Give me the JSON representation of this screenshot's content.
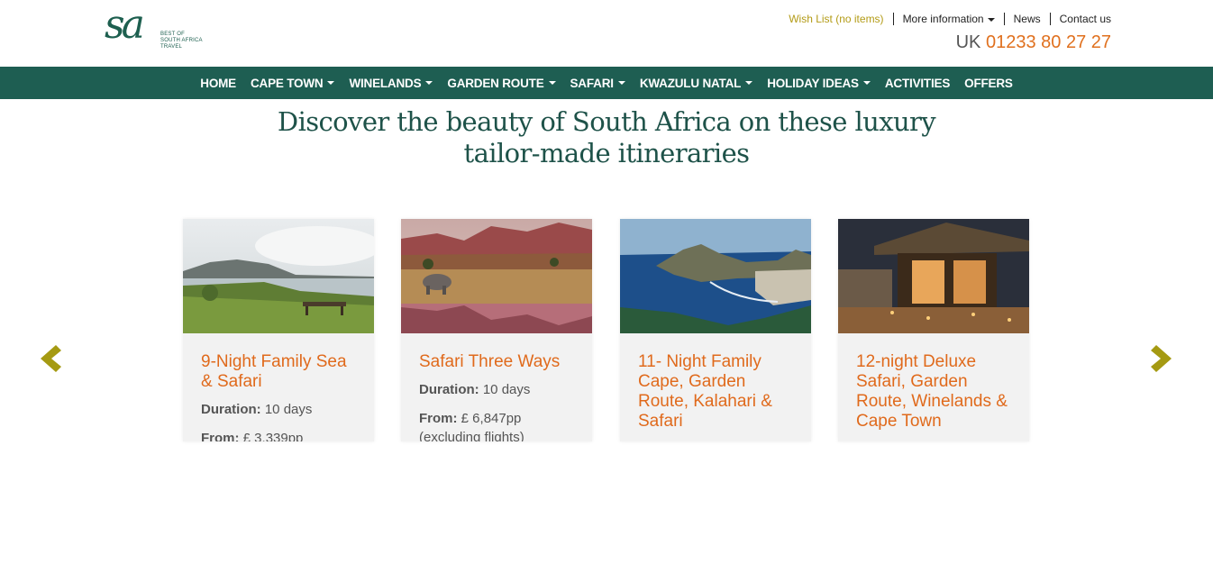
{
  "logo": {
    "mark": "sa",
    "lines": [
      "BEST OF",
      "SOUTH AFRICA",
      "TRAVEL"
    ]
  },
  "top_links": {
    "wish_list": "Wish List (no items)",
    "more_info": "More information",
    "news": "News",
    "contact": "Contact us"
  },
  "phone": {
    "prefix": "UK",
    "number": "01233 80 27 27"
  },
  "nav": {
    "items": [
      {
        "label": "HOME",
        "dropdown": false
      },
      {
        "label": "CAPE TOWN",
        "dropdown": true
      },
      {
        "label": "WINELANDS",
        "dropdown": true
      },
      {
        "label": "GARDEN ROUTE",
        "dropdown": true
      },
      {
        "label": "SAFARI",
        "dropdown": true
      },
      {
        "label": "KWAZULU NATAL",
        "dropdown": true
      },
      {
        "label": "HOLIDAY IDEAS",
        "dropdown": true
      },
      {
        "label": "ACTIVITIES",
        "dropdown": false
      },
      {
        "label": "OFFERS",
        "dropdown": false
      }
    ]
  },
  "hero": {
    "line1": "Discover the beauty of South Africa on these luxury",
    "line2": "tailor-made itineraries"
  },
  "cards": [
    {
      "title": "9-Night Family Sea & Safari",
      "duration_label": "Duration:",
      "duration": "10 days",
      "from_label": "From:",
      "price": "£ 3,339pp",
      "note": ""
    },
    {
      "title": "Safari Three Ways",
      "duration_label": "Duration:",
      "duration": "10 days",
      "from_label": "From:",
      "price": "£ 6,847pp",
      "note": "(excluding flights)"
    },
    {
      "title": "11- Night Family Cape, Garden Route, Kalahari & Safari",
      "duration_label": "",
      "duration": "",
      "from_label": "",
      "price": "",
      "note": ""
    },
    {
      "title": "12-night Deluxe Safari, Garden Route, Winelands & Cape Town",
      "duration_label": "",
      "duration": "",
      "from_label": "",
      "price": "",
      "note": ""
    }
  ],
  "colors": {
    "brand_green": "#1e5e52",
    "title_green": "#1e5249",
    "accent_orange": "#e06a1c",
    "wish_gold": "#b39b16",
    "arrow_gold": "#a59a12"
  },
  "icons": {
    "prev": "chevron-left-icon",
    "next": "chevron-right-icon"
  }
}
